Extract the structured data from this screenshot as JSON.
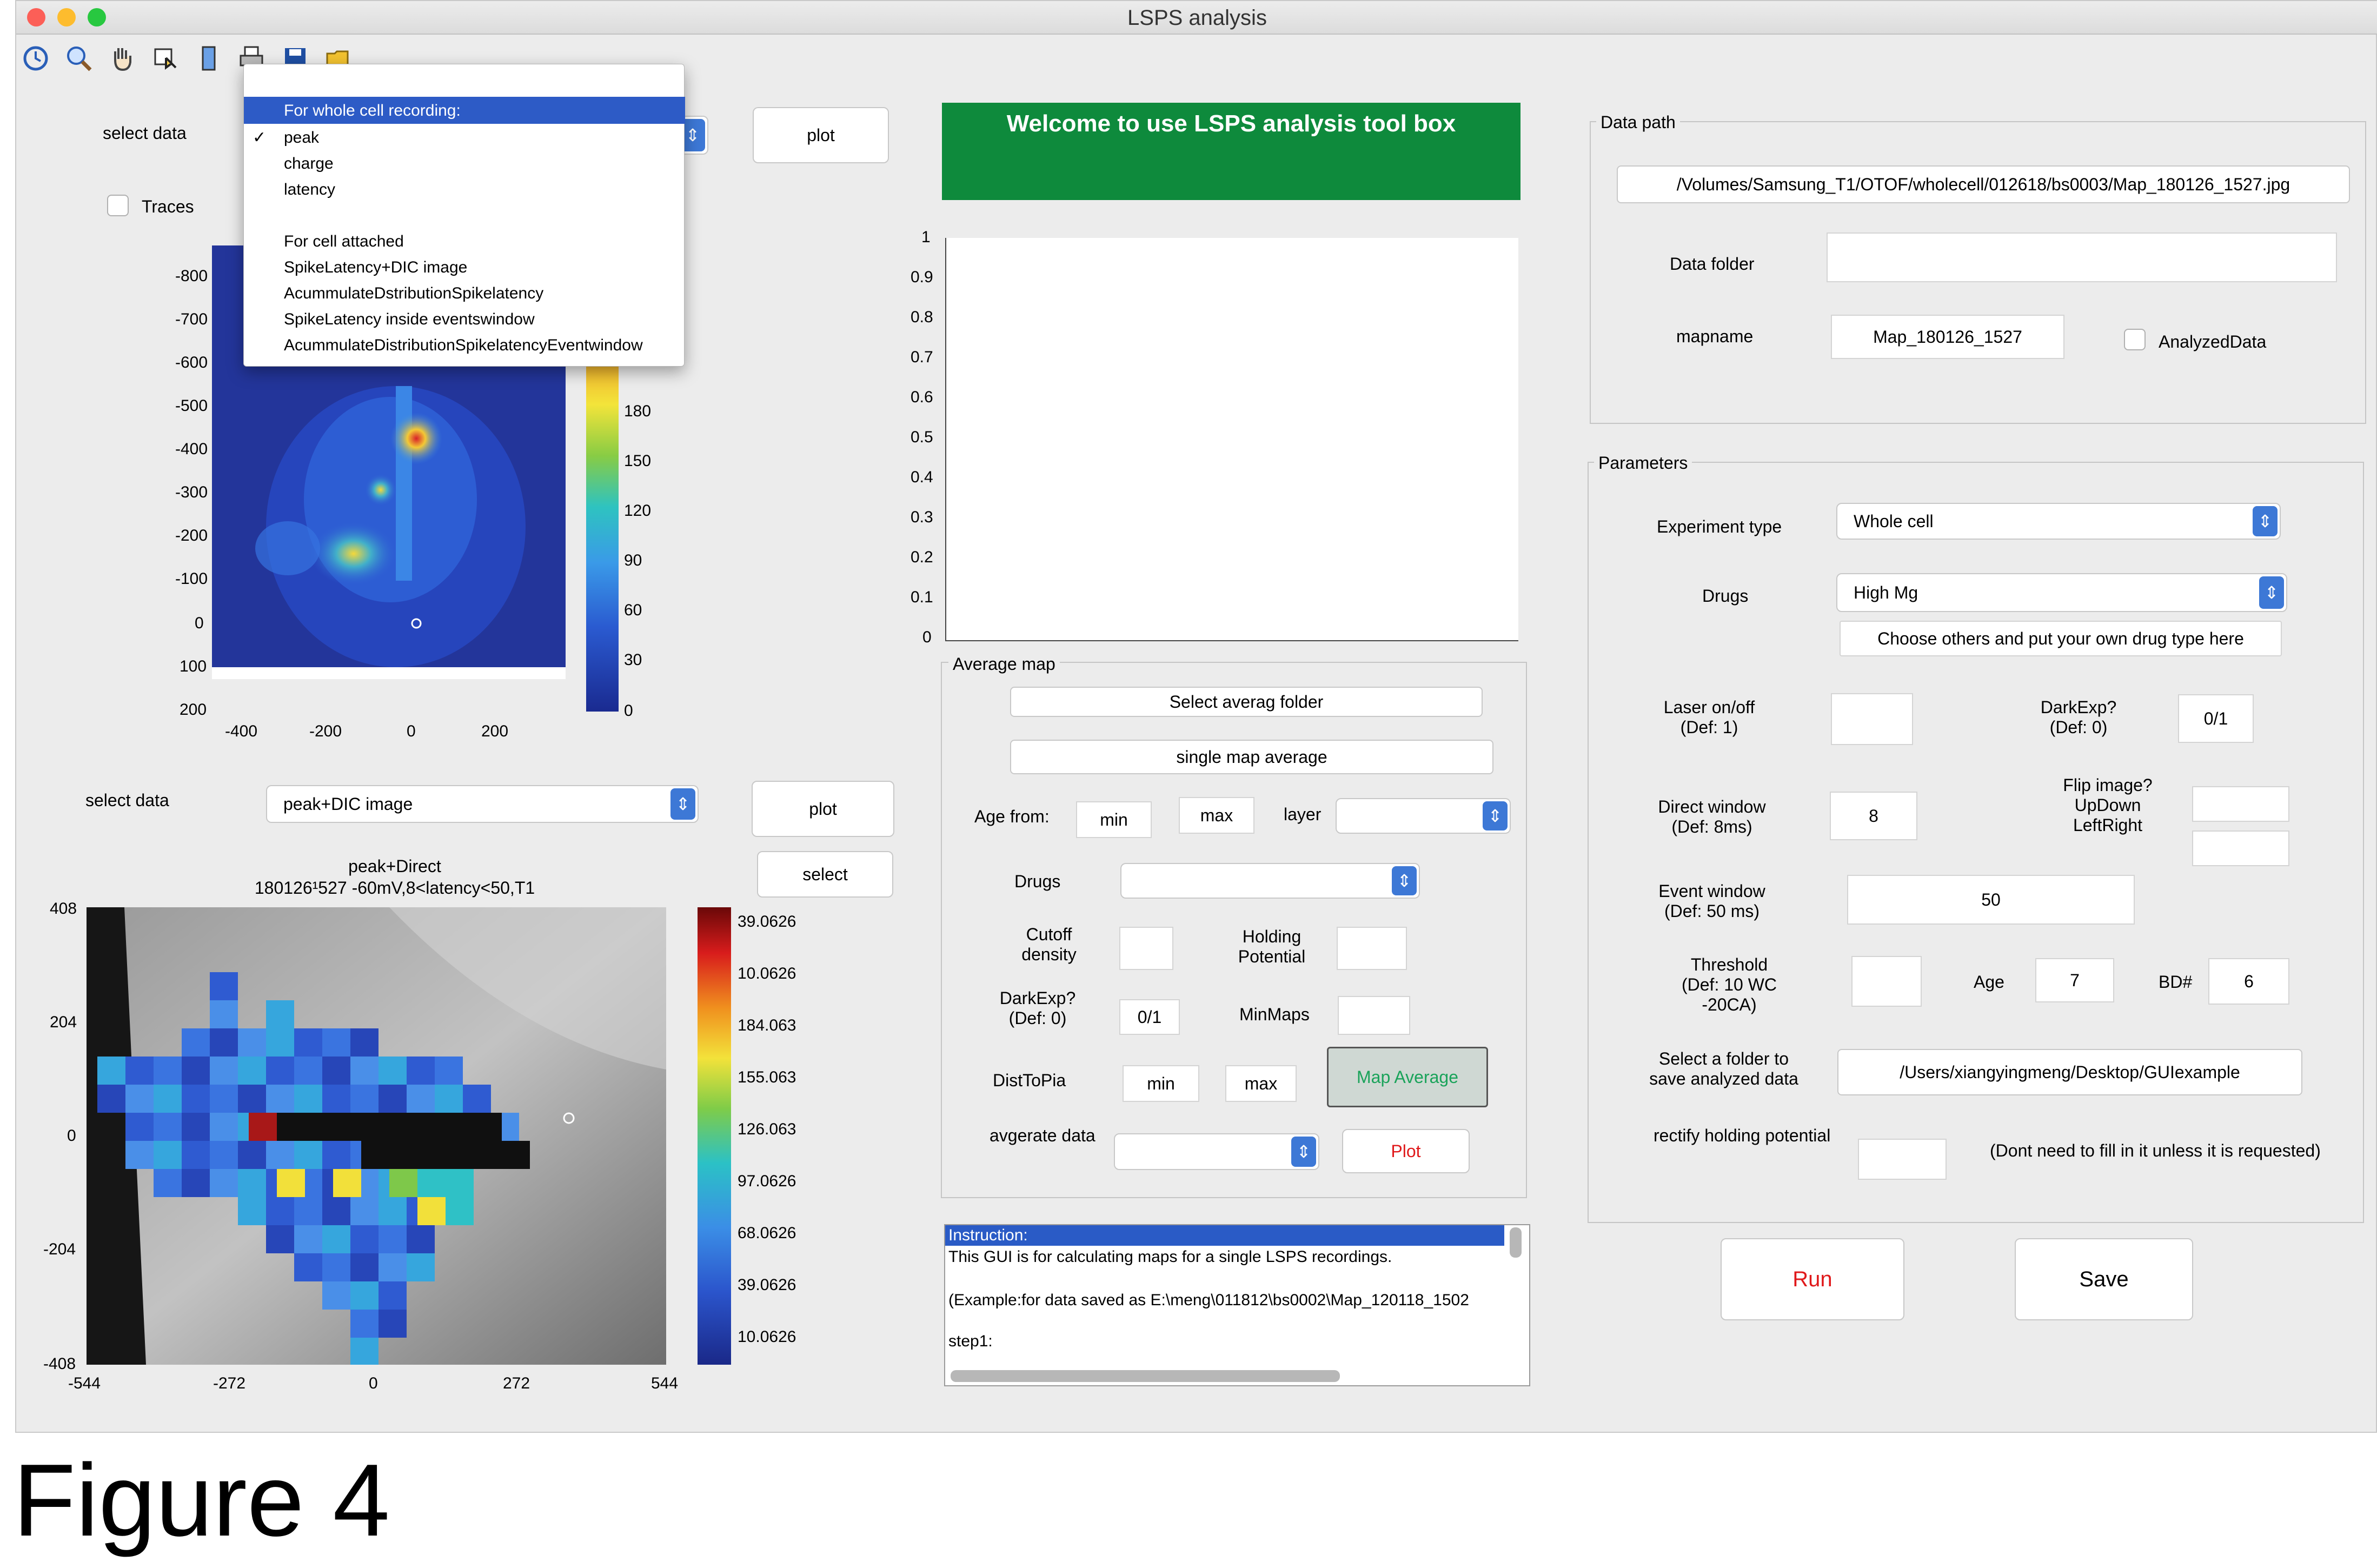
{
  "window": {
    "title": "LSPS analysis"
  },
  "toolbar": {
    "icons": [
      "rotate-icon",
      "zoom-in-icon",
      "pan-hand-icon",
      "data-cursor-icon",
      "colorbar-icon",
      "print-icon",
      "save-icon",
      "open-folder-icon"
    ]
  },
  "top_left": {
    "select_label": "select data",
    "traces_label": "Traces",
    "plot_label": "plot"
  },
  "menu": {
    "header": "For whole cell recording:",
    "items": [
      "peak",
      "charge",
      "latency"
    ],
    "checked": "✓",
    "section2": "For cell attached",
    "items2": [
      "SpikeLatency+DIC image",
      "AcummulateDstributionSpikelatency",
      "SpikeLatency inside eventswindow",
      "AcummulateDistributionSpikelatencyEventwindow"
    ]
  },
  "heatmap1": {
    "yticks": [
      "-800",
      "-700",
      "-600",
      "-500",
      "-400",
      "-300",
      "-200",
      "-100",
      "0",
      "100",
      "200"
    ],
    "xticks": [
      "-400",
      "-200",
      "0",
      "200"
    ],
    "cticks": [
      "180",
      "150",
      "120",
      "90",
      "60",
      "30",
      "0"
    ]
  },
  "bottom_left": {
    "select_label": "select data",
    "select_value": "peak+DIC image",
    "plot_label": "plot",
    "select_button": "select"
  },
  "heatmap2": {
    "title1": "peak+Direct",
    "title2": "180126¹527 -60mV,8<latency<50,T1",
    "yticks": [
      "408",
      "204",
      "0",
      "-204",
      "-408"
    ],
    "xticks": [
      "-544",
      "-272",
      "0",
      "272",
      "544"
    ],
    "cticks": [
      "39.0626",
      "10.0626",
      "184.063",
      "155.063",
      "126.063",
      "97.0626",
      "68.0626",
      "39.0626",
      "10.0626"
    ]
  },
  "banner": {
    "text": "Welcome to use LSPS analysis tool box",
    "color": "#0e8a3c"
  },
  "empty_axes": {
    "yticks": [
      "1",
      "0.9",
      "0.8",
      "0.7",
      "0.6",
      "0.5",
      "0.4",
      "0.3",
      "0.2",
      "0.1",
      "0"
    ]
  },
  "average_map": {
    "title": "Average map",
    "select_folder": "Select averag folder",
    "single_avg": "single map average",
    "age_from": "Age from:",
    "min": "min",
    "max": "max",
    "layer": "layer",
    "drugs": "Drugs",
    "cutoff": "Cutoff density",
    "holding": "Holding Potential",
    "darkexp": "DarkExp? (Def: 0)",
    "darkexp_value": "0/1",
    "minmaps": "MinMaps",
    "disttopia": "DistToPia",
    "map_average": "Map Average",
    "avg_data": "avgerate data",
    "plot": "Plot"
  },
  "instruction": {
    "lines": [
      "Instruction:",
      "This GUI is for calculating maps for a single LSPS recordings.",
      "",
      "(Example:for data saved as E:\\meng\\011812\\bs0002\\Map_120118_1502",
      "",
      "step1:"
    ]
  },
  "data_path": {
    "title": "Data path",
    "path": "/Volumes/Samsung_T1/OTOF/wholecell/012618/bs0003/Map_180126_1527.jpg",
    "folder_label": "Data folder",
    "folder_value": "",
    "mapname_label": "mapname",
    "mapname_value": "Map_180126_1527",
    "analyzed_label": "AnalyzedData"
  },
  "parameters": {
    "title": "Parameters",
    "exp_type_label": "Experiment type",
    "exp_type_value": "Whole cell",
    "drugs_label": "Drugs",
    "drugs_value": "High Mg",
    "drugs_button": "Choose others and put your own drug type here",
    "laser_label": "Laser on/off (Def: 1)",
    "darkexp_label": "DarkExp? (Def: 0)",
    "darkexp_value": "0/1",
    "direct_label": "Direct window (Def: 8ms)",
    "direct_value": "8",
    "flip_label": "Flip image? UpDown LeftRight",
    "event_label": "Event window (Def: 50 ms)",
    "event_value": "50",
    "threshold_label": "Threshold (Def: 10 WC -20CA)",
    "age_label": "Age",
    "age_value": "7",
    "bd_label": "BD#",
    "bd_value": "6",
    "save_folder_label": "Select a folder to save analyzed data",
    "save_folder_value": "/Users/xiangyingmeng/Desktop/GUIexample",
    "rectify_label": "rectify holding potential",
    "rectify_note": "(Dont need to fill in it unless it is requested)"
  },
  "actions": {
    "run": "Run",
    "save": "Save",
    "run_color": "#e0191b"
  },
  "caption": "Figure 4"
}
